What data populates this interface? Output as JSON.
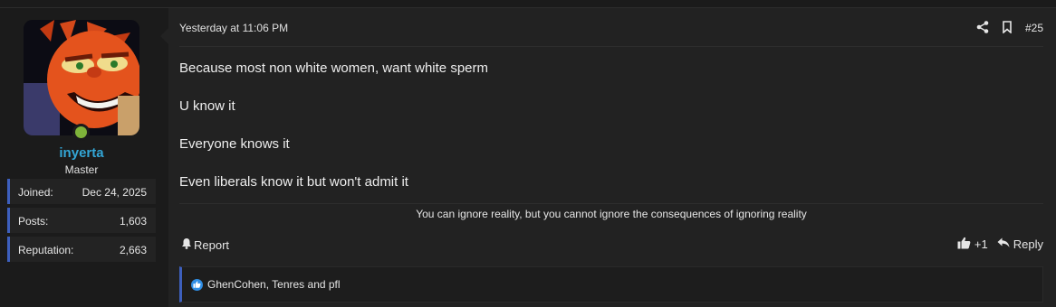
{
  "user": {
    "username": "inyerta",
    "title": "Master",
    "stats": [
      {
        "label": "Joined:",
        "value": "Dec 24, 2025"
      },
      {
        "label": "Posts:",
        "value": "1,603"
      },
      {
        "label": "Reputation:",
        "value": "2,663"
      }
    ],
    "online_color": "#7fb43a",
    "username_color": "#33a6d6"
  },
  "post": {
    "timestamp": "Yesterday at 11:06 PM",
    "number": "#25",
    "paragraphs": [
      "Because most non white women, want white sperm",
      "U know it",
      "Everyone knows it",
      "Even liberals know it but won't admit it"
    ],
    "signature": "You can ignore reality, but you cannot ignore the consequences of ignoring reality"
  },
  "actions": {
    "report_label": "Report",
    "like_count": "+1",
    "reply_label": "Reply"
  },
  "reactions": {
    "text": "GhenCohen, Tenres and pfl"
  },
  "icons": {
    "share": "share-icon",
    "bookmark": "bookmark-icon",
    "report": "bell-icon",
    "like": "thumbs-up-icon",
    "reply": "reply-icon"
  },
  "accent_color": "#3d5fbd"
}
